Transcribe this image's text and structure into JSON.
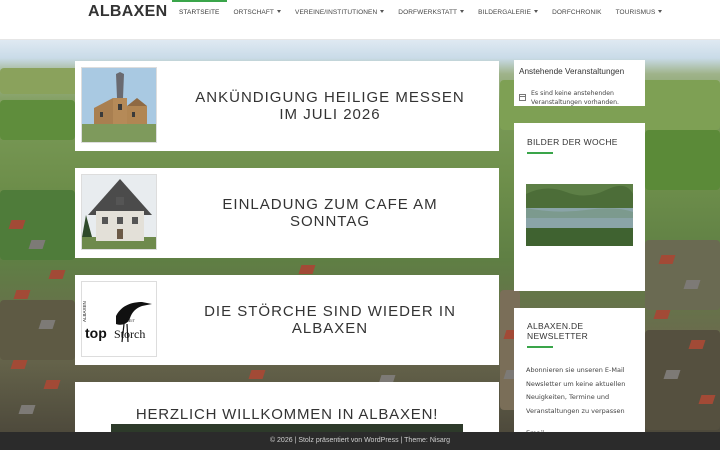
{
  "site": {
    "logo": "ALBAXEN"
  },
  "nav": {
    "items": [
      {
        "label": "STARTSEITE",
        "dropdown": false,
        "active": true
      },
      {
        "label": "ORTSCHAFT",
        "dropdown": true,
        "active": false
      },
      {
        "label": "VEREINE/INSTITUTIONEN",
        "dropdown": true,
        "active": false
      },
      {
        "label": "DORFWERKSTATT",
        "dropdown": true,
        "active": false
      },
      {
        "label": "BILDERGALERIE",
        "dropdown": true,
        "active": false
      },
      {
        "label": "DORFCHRONIK",
        "dropdown": false,
        "active": false
      },
      {
        "label": "TOURISMUS",
        "dropdown": true,
        "active": false
      }
    ]
  },
  "posts": [
    {
      "title_line1": "ANKÜNDIGUNG HEILIGE MESSEN",
      "title_line2": "IM JULI 2026",
      "thumb": "church-tower-image"
    },
    {
      "title_line1": "EINLADUNG ZUM CAFE AM",
      "title_line2": "SONNTAG",
      "thumb": "house-image"
    },
    {
      "title_line1": "DIE STÖRCHE SIND WIEDER IN",
      "title_line2": "ALBAXEN",
      "thumb": "top-storch-logo",
      "thumb_text": {
        "small": "ALBAXEN",
        "big": "top",
        "big2": "Storch",
        "side": "SEIT"
      }
    }
  ],
  "welcome": {
    "title": "HERZLICH WILLKOMMEN IN ALBAXEN!"
  },
  "sidebar": {
    "events": {
      "title": "Anstehende Veranstaltungen",
      "text": "Es sind keine anstehenden Veranstaltungen vorhanden."
    },
    "gallery": {
      "title": "BILDER DER WOCHE"
    },
    "newsletter": {
      "title_line1": "ALBAXEN.DE",
      "title_line2": "NEWSLETTER",
      "text": "Abonnieren sie unseren E-Mail Newsletter um keine aktuellen Neuigkeiten, Termine und Veranstaltungen zu verpassen",
      "email_label": "Email"
    }
  },
  "footer": {
    "text": "© 2026 | Stolz präsentiert von WordPress | Theme: Nisarg"
  },
  "colors": {
    "accent": "#3aa54a",
    "footer_bg": "#2b2b2b"
  }
}
